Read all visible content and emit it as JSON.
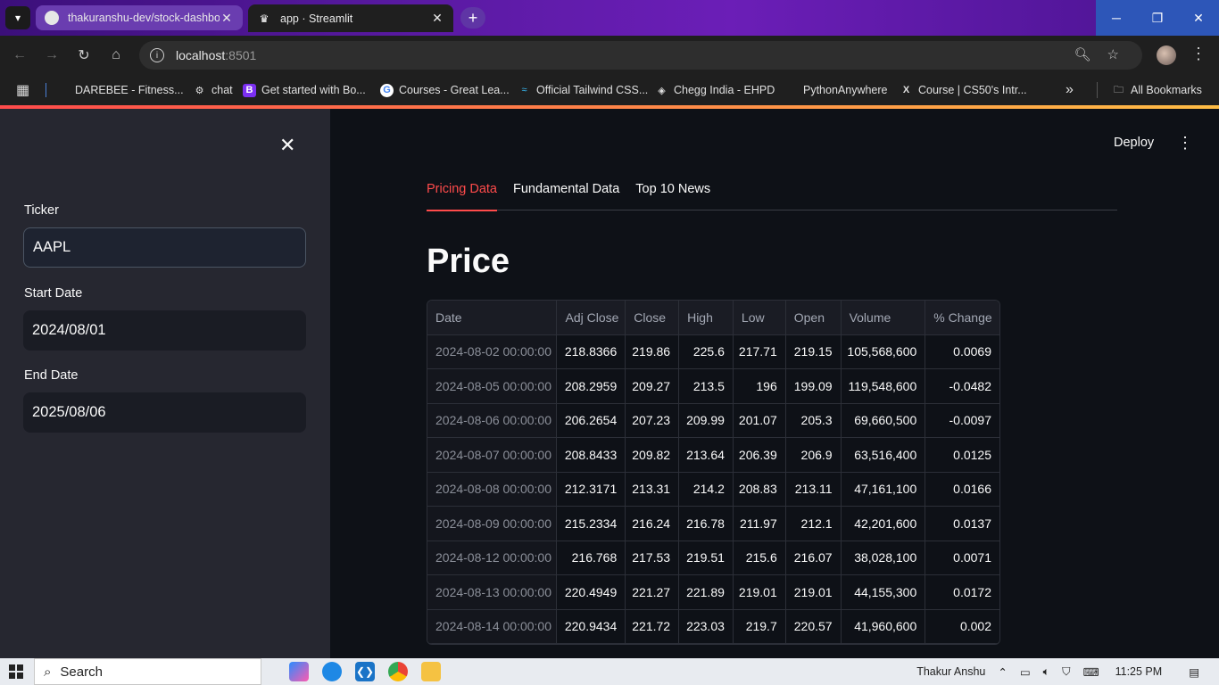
{
  "browser": {
    "tabs": [
      {
        "title": "thakuranshu-dev/stock-dashbo",
        "close": "✕"
      },
      {
        "title": "app · Streamlit",
        "close": "✕"
      }
    ],
    "new_tab": "+",
    "url_host": "localhost",
    "url_port": ":8501",
    "bookmarks": [
      {
        "label": "DAREBEE - Fitness..."
      },
      {
        "label": "chat"
      },
      {
        "label": "Get started with Bo..."
      },
      {
        "label": "Courses - Great Lea..."
      },
      {
        "label": "Official Tailwind CSS..."
      },
      {
        "label": "Chegg India - EHPD"
      },
      {
        "label": "PythonAnywhere"
      },
      {
        "label": "Course | CS50's Intr..."
      }
    ],
    "more_bookmarks": "»",
    "all_bookmarks": "All Bookmarks"
  },
  "sidebar": {
    "close": "✕",
    "ticker_label": "Ticker",
    "ticker_value": "AAPL",
    "start_label": "Start Date",
    "start_value": "2024/08/01",
    "end_label": "End Date",
    "end_value": "2025/08/06"
  },
  "main": {
    "deploy": "Deploy",
    "tabs": [
      "Pricing Data",
      "Fundamental Data",
      "Top 10 News"
    ],
    "heading": "Price",
    "table": {
      "headers": [
        "Date",
        "Adj Close",
        "Close",
        "High",
        "Low",
        "Open",
        "Volume",
        "% Change"
      ],
      "rows": [
        [
          "2024-08-02 00:00:00",
          "218.8366",
          "219.86",
          "225.6",
          "217.71",
          "219.15",
          "105,568,600",
          "0.0069"
        ],
        [
          "2024-08-05 00:00:00",
          "208.2959",
          "209.27",
          "213.5",
          "196",
          "199.09",
          "119,548,600",
          "-0.0482"
        ],
        [
          "2024-08-06 00:00:00",
          "206.2654",
          "207.23",
          "209.99",
          "201.07",
          "205.3",
          "69,660,500",
          "-0.0097"
        ],
        [
          "2024-08-07 00:00:00",
          "208.8433",
          "209.82",
          "213.64",
          "206.39",
          "206.9",
          "63,516,400",
          "0.0125"
        ],
        [
          "2024-08-08 00:00:00",
          "212.3171",
          "213.31",
          "214.2",
          "208.83",
          "213.11",
          "47,161,100",
          "0.0166"
        ],
        [
          "2024-08-09 00:00:00",
          "215.2334",
          "216.24",
          "216.78",
          "211.97",
          "212.1",
          "42,201,600",
          "0.0137"
        ],
        [
          "2024-08-12 00:00:00",
          "216.768",
          "217.53",
          "219.51",
          "215.6",
          "216.07",
          "38,028,100",
          "0.0071"
        ],
        [
          "2024-08-13 00:00:00",
          "220.4949",
          "221.27",
          "221.89",
          "219.01",
          "219.01",
          "44,155,300",
          "0.0172"
        ],
        [
          "2024-08-14 00:00:00",
          "220.9434",
          "221.72",
          "223.03",
          "219.7",
          "220.57",
          "41,960,600",
          "0.002"
        ]
      ]
    }
  },
  "taskbar": {
    "search_placeholder": "Search",
    "user": "Thakur Anshu",
    "time": "11:25 PM"
  }
}
